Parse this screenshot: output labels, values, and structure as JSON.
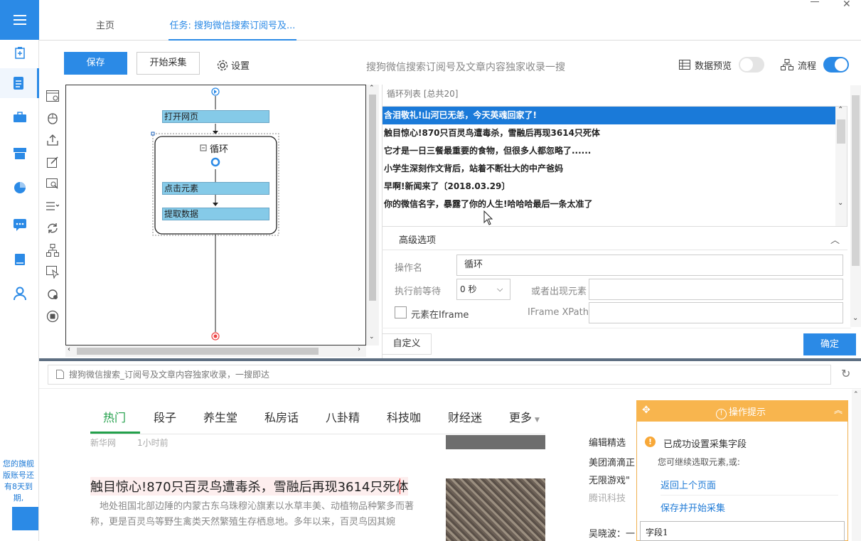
{
  "colors": {
    "accent": "#2b8ae6",
    "selected_row": "#1a7ad9",
    "node_fill": "#85cae8",
    "hot_green": "#23a04b",
    "tip_orange": "#f8b54e"
  },
  "leftnav": {
    "icons": [
      "menu-icon",
      "task-add-icon",
      "document-icon",
      "briefcase-icon",
      "store-icon",
      "pie-chart-icon",
      "chat-icon",
      "book-icon",
      "user-icon"
    ],
    "vip_notice": "您的旗舰版账号还有8天到期,"
  },
  "tabs": {
    "home": "主页",
    "task": "任务: 搜狗微信搜索订阅号及..."
  },
  "toolbar": {
    "save": "保存",
    "start": "开始采集",
    "settings": "设置",
    "task_title": "搜狗微信搜索订阅号及文章内容独家收录一搜",
    "data_preview": "数据预览",
    "data_preview_on": false,
    "flow": "流程",
    "flow_on": true
  },
  "flow": {
    "open_page": "打开网页",
    "loop": "循环",
    "click": "点击元素",
    "extract": "提取数据"
  },
  "loop_list": {
    "title": "循环列表 [总共20]",
    "items": [
      "含泪敬礼!山河已无恙，今天英魂回家了!",
      "触目惊心!870只百灵鸟遭毒杀，雪融后再现3614只死体",
      "它才是一日三餐最重要的食物，但很多人都忽略了......",
      "小学生深刻作文背后，站着不断壮大的中产爸妈",
      "早啊!新闻来了〔2018.03.29〕",
      "你的微信名字，暴露了你的人生!哈哈哈最后一条太准了"
    ]
  },
  "advanced": {
    "title": "高级选项",
    "op_name_label": "操作名",
    "op_name": "循环",
    "wait_label": "执行前等待",
    "wait_value": "0 秒",
    "or_appear_label": "或者出现元素",
    "in_iframe_label": "元素在Iframe",
    "iframe_xpath_label": "IFrame XPath"
  },
  "buttons": {
    "custom": "自定义",
    "ok": "确定"
  },
  "browser": {
    "url": "搜狗微信搜索_订阅号及文章内容独家收录，一搜即达"
  },
  "web": {
    "categories": [
      "热门",
      "段子",
      "养生堂",
      "私房话",
      "八卦精",
      "科技咖",
      "财经迷",
      "更多"
    ],
    "source": "新华网",
    "time": "1小时前",
    "headline": "触目惊心!870只百灵鸟遭毒杀，雪融后再现3614只死体",
    "summary": "地处祖国北部边陲的内蒙古东乌珠穆沁旗素以水草丰美、动植物品种繁多而著称，更是百灵鸟等野生禽类天然繁殖生存栖息地。多年以来，百灵鸟因其婉",
    "side_title": "编辑精选",
    "side_1": "美团滴滴正",
    "side_2": "无限游戏\"",
    "side_3": "腾讯科技",
    "side_4": "吴晓波：一"
  },
  "tip": {
    "header": "操作提示",
    "title": "已成功设置采集字段",
    "sub": "您可继续选取元素,或:",
    "back": "返回上个页面",
    "save_start": "保存并开始采集",
    "field": "字段1"
  }
}
